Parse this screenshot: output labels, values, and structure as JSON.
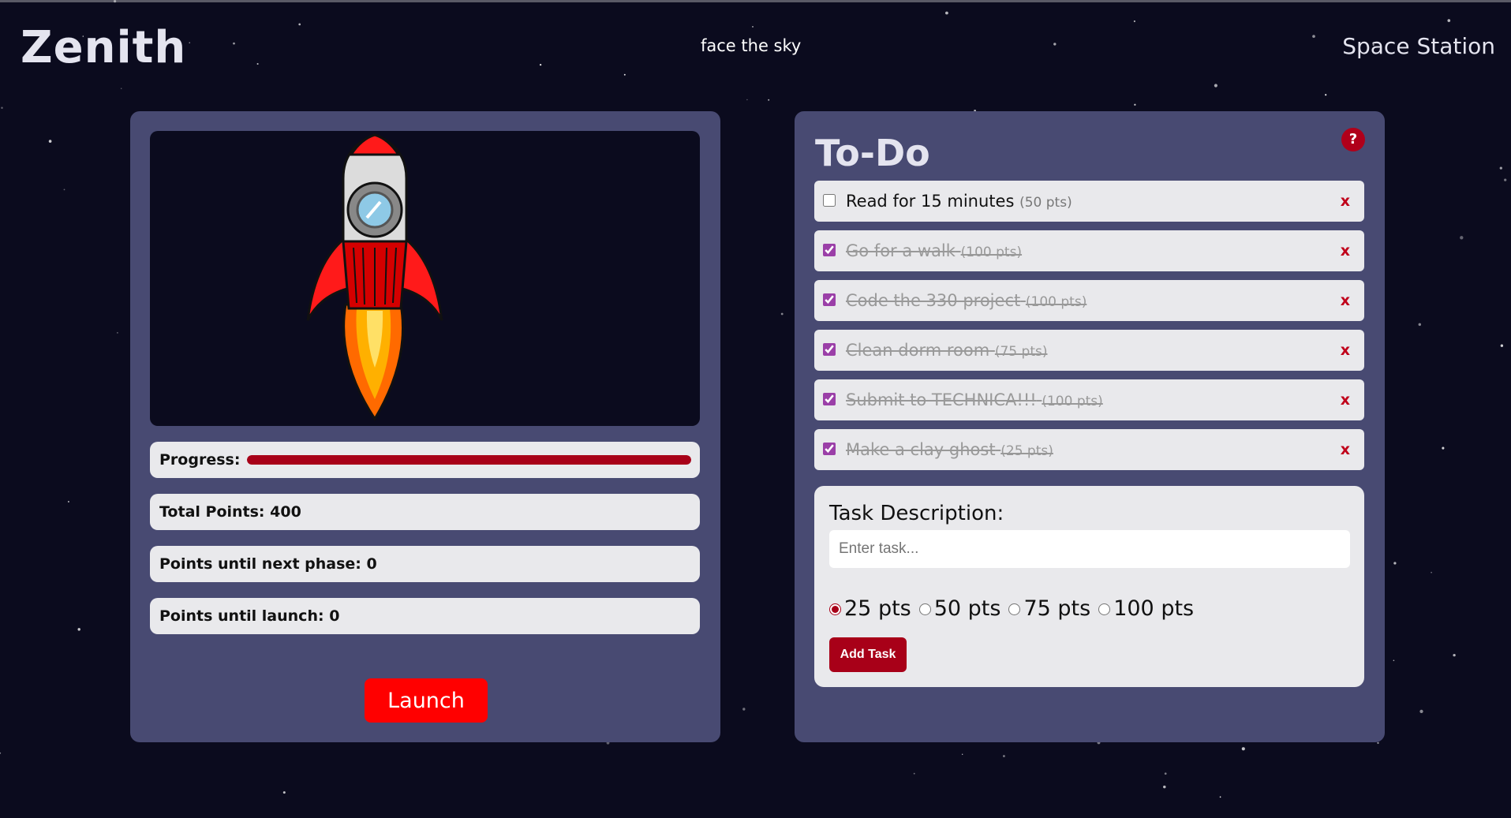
{
  "header": {
    "title": "Zenith",
    "tagline": "face the sky",
    "nav_link": "Space Station"
  },
  "rocket_panel": {
    "progress": {
      "label": "Progress:",
      "percent": 100
    },
    "total_points": "Total Points: 400",
    "points_next_phase": "Points until next phase: 0",
    "points_launch": "Points until launch: 0",
    "launch_label": "Launch"
  },
  "todo": {
    "title": "To-Do",
    "help_icon": "?",
    "tasks": [
      {
        "text": "Read for 15 minutes",
        "points": "(50 pts)",
        "done": false
      },
      {
        "text": "Go for a walk",
        "points": "(100 pts)",
        "done": true
      },
      {
        "text": "Code the 330 project",
        "points": "(100 pts)",
        "done": true
      },
      {
        "text": "Clean dorm room",
        "points": "(75 pts)",
        "done": true
      },
      {
        "text": "Submit to TECHNICA!!!",
        "points": "(100 pts)",
        "done": true
      },
      {
        "text": "Make a clay ghost",
        "points": "(25 pts)",
        "done": true
      }
    ],
    "delete_symbol": "x",
    "form": {
      "label": "Task Description:",
      "placeholder": "Enter task...",
      "options": [
        "25 pts",
        "50 pts",
        "75 pts",
        "100 pts"
      ],
      "selected_option": "25 pts",
      "add_label": "Add Task"
    }
  },
  "colors": {
    "background": "#0b0b1e",
    "panel": "#484a72",
    "accent_red": "#a80018",
    "launch_red": "#ff0000",
    "checkbox_purple": "#9b3fa8"
  }
}
